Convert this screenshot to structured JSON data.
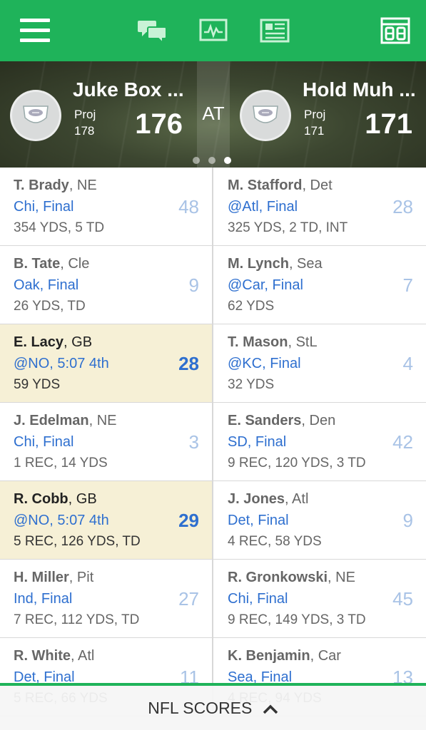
{
  "matchup": {
    "at_label": "AT",
    "home": {
      "name": "Juke Box ...",
      "proj_label": "Proj",
      "proj": "178",
      "score": "176"
    },
    "away": {
      "name": "Hold Muh ...",
      "proj_label": "Proj",
      "proj": "171",
      "score": "171"
    },
    "pager": {
      "count": 3,
      "active_index": 2
    }
  },
  "players": [
    {
      "left": {
        "name": "T. Brady",
        "team": ", NE",
        "game": "Chi, Final",
        "stats": "354 YDS, 5 TD",
        "pts": "48",
        "highlight": false
      },
      "right": {
        "name": "M. Stafford",
        "team": ", Det",
        "game": "@Atl, Final",
        "stats": "325 YDS, 2 TD, INT",
        "pts": "28",
        "highlight": false
      }
    },
    {
      "left": {
        "name": "B. Tate",
        "team": ", Cle",
        "game": "Oak, Final",
        "stats": "26 YDS, TD",
        "pts": "9",
        "highlight": false
      },
      "right": {
        "name": "M. Lynch",
        "team": ", Sea",
        "game": "@Car, Final",
        "stats": "62 YDS",
        "pts": "7",
        "highlight": false
      }
    },
    {
      "left": {
        "name": "E. Lacy",
        "team": ", GB",
        "game": "@NO, 5:07 4th",
        "stats": "59 YDS",
        "pts": "28",
        "highlight": true
      },
      "right": {
        "name": "T. Mason",
        "team": ", StL",
        "game": "@KC, Final",
        "stats": "32 YDS",
        "pts": "4",
        "highlight": false
      }
    },
    {
      "left": {
        "name": "J. Edelman",
        "team": ", NE",
        "game": "Chi, Final",
        "stats": "1 REC, 14 YDS",
        "pts": "3",
        "highlight": false
      },
      "right": {
        "name": "E. Sanders",
        "team": ", Den",
        "game": "SD, Final",
        "stats": "9 REC, 120 YDS, 3 TD",
        "pts": "42",
        "highlight": false
      }
    },
    {
      "left": {
        "name": "R. Cobb",
        "team": ", GB",
        "game": "@NO, 5:07 4th",
        "stats": "5 REC, 126 YDS, TD",
        "pts": "29",
        "highlight": true
      },
      "right": {
        "name": "J. Jones",
        "team": ", Atl",
        "game": "Det, Final",
        "stats": "4 REC, 58 YDS",
        "pts": "9",
        "highlight": false
      }
    },
    {
      "left": {
        "name": "H. Miller",
        "team": ", Pit",
        "game": "Ind, Final",
        "stats": "7 REC, 112 YDS, TD",
        "pts": "27",
        "highlight": false
      },
      "right": {
        "name": "R. Gronkowski",
        "team": ", NE",
        "game": "Chi, Final",
        "stats": "9 REC, 149 YDS, 3 TD",
        "pts": "45",
        "highlight": false
      }
    },
    {
      "left": {
        "name": "R. White",
        "team": ", Atl",
        "game": "Det, Final",
        "stats": "5 REC, 66 YDS",
        "pts": "11",
        "highlight": false
      },
      "right": {
        "name": "K. Benjamin",
        "team": ", Car",
        "game": "Sea, Final",
        "stats": "4 REC, 94 YDS",
        "pts": "13",
        "highlight": false
      }
    }
  ],
  "bottom_bar": {
    "label": "NFL SCORES"
  },
  "colors": {
    "brand_green": "#1fb35a",
    "link_blue": "#2e6fcf",
    "highlight_bg": "#f6f0d6"
  },
  "icons": [
    "menu-icon",
    "chat-icon",
    "activity-icon",
    "news-icon",
    "scoreboard-icon",
    "chevron-up-icon"
  ]
}
